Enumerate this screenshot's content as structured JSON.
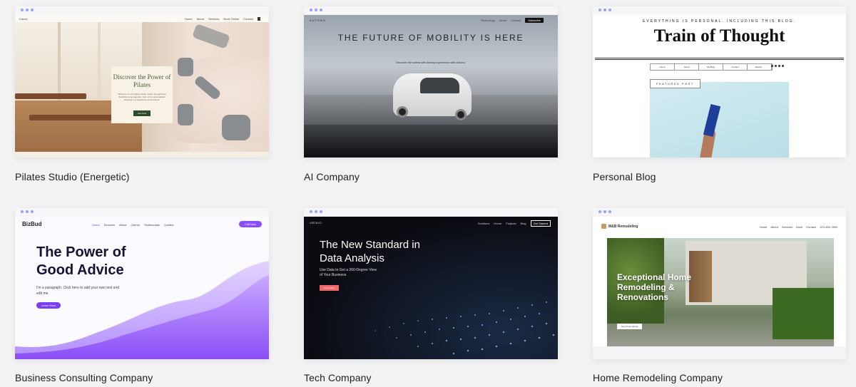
{
  "cards": [
    {
      "caption": "Pilates Studio (Energetic)",
      "preview": {
        "logo": "Canvo",
        "nav": [
          "Home",
          "About",
          "Services",
          "Book Online",
          "Contact"
        ],
        "headline": "Discover the Power of Pilates",
        "body": "Welcome to our Pilates studio, where strength and flexibility come together. Join us for personalized sessions in a supportive environment.",
        "button": "Join Now"
      }
    },
    {
      "caption": "AI Company",
      "preview": {
        "logo": "AUTONO",
        "nav": [
          "Technology",
          "About",
          "Contact"
        ],
        "nav_button": "Subscribe",
        "headline": "THE FUTURE OF MOBILITY IS HERE",
        "subtext": "Discover the safest self-driving experience with Autono."
      }
    },
    {
      "caption": "Personal Blog",
      "preview": {
        "tagline": "EVERYTHING IS PERSONAL. INCLUDING THIS BLOG.",
        "title": "Train of Thought",
        "nav": [
          "Home",
          "About",
          "My Blog",
          "Contact",
          "Search..."
        ],
        "featured_label": "FEATURED POST"
      }
    },
    {
      "caption": "Business Consulting Company",
      "preview": {
        "logo": "BizBud",
        "nav": [
          "Home",
          "Services",
          "About",
          "Clients",
          "Testimonials",
          "Contact"
        ],
        "nav_button": "Call Now",
        "headline": "The Power of Good Advice",
        "body": "I'm a paragraph. Click here to add your own text and edit me.",
        "button": "Learn More"
      }
    },
    {
      "caption": "Tech Company",
      "preview": {
        "logo": "VISTA.IO",
        "nav": [
          "Solutions",
          "Home",
          "Projects",
          "Blog"
        ],
        "nav_button": "Get Started",
        "headline": "The New Standard in Data Analysis",
        "subtext": "Use Data to Get a 360-Degree View of Your Business",
        "button": "Learn More"
      }
    },
    {
      "caption": "Home Remodeling Company",
      "preview": {
        "logo": "M&B Remodeling",
        "nav": [
          "Home",
          "About",
          "Services",
          "Book",
          "Contact"
        ],
        "phone": "123-456-7890",
        "headline": "Exceptional Home Remodeling & Renovations",
        "button": "Get a Free Quote"
      }
    }
  ],
  "colors": {
    "page_bg": "#f3f3f4",
    "pilates_button": "#2f4a2a",
    "biz_accent": "#8a4dff",
    "tech_button": "#f06a6a",
    "blog_book": "#1d3f9a"
  }
}
